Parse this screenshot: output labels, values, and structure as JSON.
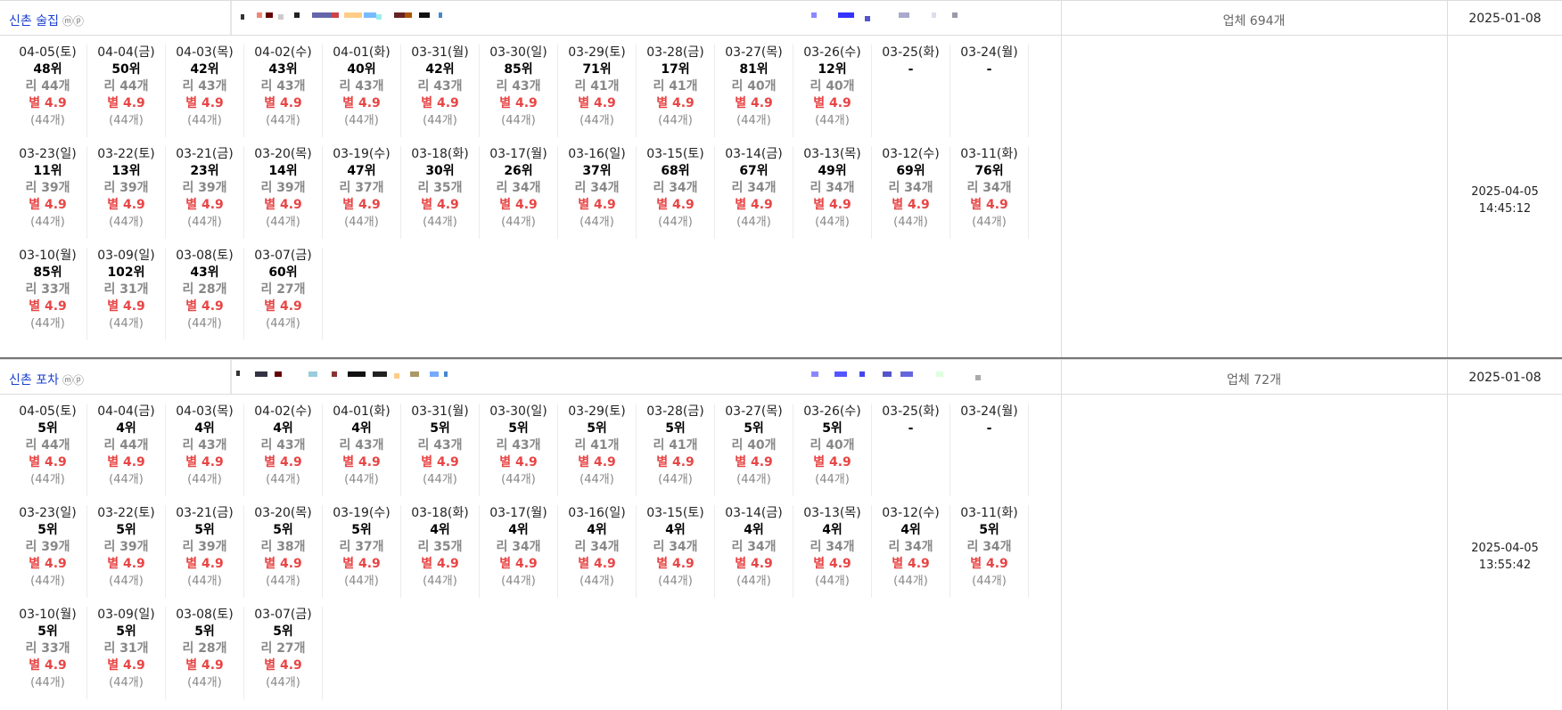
{
  "groups": [
    {
      "keyword": "신촌 술집",
      "mp": "ⓜⓟ",
      "business_count": "업체 694개",
      "registered": "2025-01-08",
      "updated_date": "2025-04-05",
      "updated_time": "14:45:12",
      "days": [
        {
          "date": "04-05(토)",
          "rank": "48위",
          "reviews": "리 44개",
          "stars": "별 4.9",
          "count": "(44개)"
        },
        {
          "date": "04-04(금)",
          "rank": "50위",
          "reviews": "리 44개",
          "stars": "별 4.9",
          "count": "(44개)"
        },
        {
          "date": "04-03(목)",
          "rank": "42위",
          "reviews": "리 43개",
          "stars": "별 4.9",
          "count": "(44개)"
        },
        {
          "date": "04-02(수)",
          "rank": "43위",
          "reviews": "리 43개",
          "stars": "별 4.9",
          "count": "(44개)"
        },
        {
          "date": "04-01(화)",
          "rank": "40위",
          "reviews": "리 43개",
          "stars": "별 4.9",
          "count": "(44개)"
        },
        {
          "date": "03-31(월)",
          "rank": "42위",
          "reviews": "리 43개",
          "stars": "별 4.9",
          "count": "(44개)"
        },
        {
          "date": "03-30(일)",
          "rank": "85위",
          "reviews": "리 43개",
          "stars": "별 4.9",
          "count": "(44개)"
        },
        {
          "date": "03-29(토)",
          "rank": "71위",
          "reviews": "리 41개",
          "stars": "별 4.9",
          "count": "(44개)"
        },
        {
          "date": "03-28(금)",
          "rank": "17위",
          "reviews": "리 41개",
          "stars": "별 4.9",
          "count": "(44개)"
        },
        {
          "date": "03-27(목)",
          "rank": "81위",
          "reviews": "리 40개",
          "stars": "별 4.9",
          "count": "(44개)"
        },
        {
          "date": "03-26(수)",
          "rank": "12위",
          "reviews": "리 40개",
          "stars": "별 4.9",
          "count": "(44개)"
        },
        {
          "date": "03-25(화)",
          "rank": "-",
          "reviews": "",
          "stars": "",
          "count": ""
        },
        {
          "date": "03-24(월)",
          "rank": "-",
          "reviews": "",
          "stars": "",
          "count": ""
        },
        {
          "date": "03-23(일)",
          "rank": "11위",
          "reviews": "리 39개",
          "stars": "별 4.9",
          "count": "(44개)"
        },
        {
          "date": "03-22(토)",
          "rank": "13위",
          "reviews": "리 39개",
          "stars": "별 4.9",
          "count": "(44개)"
        },
        {
          "date": "03-21(금)",
          "rank": "23위",
          "reviews": "리 39개",
          "stars": "별 4.9",
          "count": "(44개)"
        },
        {
          "date": "03-20(목)",
          "rank": "14위",
          "reviews": "리 39개",
          "stars": "별 4.9",
          "count": "(44개)"
        },
        {
          "date": "03-19(수)",
          "rank": "47위",
          "reviews": "리 37개",
          "stars": "별 4.9",
          "count": "(44개)"
        },
        {
          "date": "03-18(화)",
          "rank": "30위",
          "reviews": "리 35개",
          "stars": "별 4.9",
          "count": "(44개)"
        },
        {
          "date": "03-17(월)",
          "rank": "26위",
          "reviews": "리 34개",
          "stars": "별 4.9",
          "count": "(44개)"
        },
        {
          "date": "03-16(일)",
          "rank": "37위",
          "reviews": "리 34개",
          "stars": "별 4.9",
          "count": "(44개)"
        },
        {
          "date": "03-15(토)",
          "rank": "68위",
          "reviews": "리 34개",
          "stars": "별 4.9",
          "count": "(44개)"
        },
        {
          "date": "03-14(금)",
          "rank": "67위",
          "reviews": "리 34개",
          "stars": "별 4.9",
          "count": "(44개)"
        },
        {
          "date": "03-13(목)",
          "rank": "49위",
          "reviews": "리 34개",
          "stars": "별 4.9",
          "count": "(44개)"
        },
        {
          "date": "03-12(수)",
          "rank": "69위",
          "reviews": "리 34개",
          "stars": "별 4.9",
          "count": "(44개)"
        },
        {
          "date": "03-11(화)",
          "rank": "76위",
          "reviews": "리 34개",
          "stars": "별 4.9",
          "count": "(44개)"
        },
        {
          "date": "03-10(월)",
          "rank": "85위",
          "reviews": "리 33개",
          "stars": "별 4.9",
          "count": "(44개)"
        },
        {
          "date": "03-09(일)",
          "rank": "102위",
          "reviews": "리 31개",
          "stars": "별 4.9",
          "count": "(44개)"
        },
        {
          "date": "03-08(토)",
          "rank": "43위",
          "reviews": "리 28개",
          "stars": "별 4.9",
          "count": "(44개)"
        },
        {
          "date": "03-07(금)",
          "rank": "60위",
          "reviews": "리 27개",
          "stars": "별 4.9",
          "count": "(44개)"
        }
      ]
    },
    {
      "keyword": "신촌 포차",
      "mp": "ⓜⓟ",
      "business_count": "업체 72개",
      "registered": "2025-01-08",
      "updated_date": "2025-04-05",
      "updated_time": "13:55:42",
      "days": [
        {
          "date": "04-05(토)",
          "rank": "5위",
          "reviews": "리 44개",
          "stars": "별 4.9",
          "count": "(44개)"
        },
        {
          "date": "04-04(금)",
          "rank": "4위",
          "reviews": "리 44개",
          "stars": "별 4.9",
          "count": "(44개)"
        },
        {
          "date": "04-03(목)",
          "rank": "4위",
          "reviews": "리 43개",
          "stars": "별 4.9",
          "count": "(44개)"
        },
        {
          "date": "04-02(수)",
          "rank": "4위",
          "reviews": "리 43개",
          "stars": "별 4.9",
          "count": "(44개)"
        },
        {
          "date": "04-01(화)",
          "rank": "4위",
          "reviews": "리 43개",
          "stars": "별 4.9",
          "count": "(44개)"
        },
        {
          "date": "03-31(월)",
          "rank": "5위",
          "reviews": "리 43개",
          "stars": "별 4.9",
          "count": "(44개)"
        },
        {
          "date": "03-30(일)",
          "rank": "5위",
          "reviews": "리 43개",
          "stars": "별 4.9",
          "count": "(44개)"
        },
        {
          "date": "03-29(토)",
          "rank": "5위",
          "reviews": "리 41개",
          "stars": "별 4.9",
          "count": "(44개)"
        },
        {
          "date": "03-28(금)",
          "rank": "5위",
          "reviews": "리 41개",
          "stars": "별 4.9",
          "count": "(44개)"
        },
        {
          "date": "03-27(목)",
          "rank": "5위",
          "reviews": "리 40개",
          "stars": "별 4.9",
          "count": "(44개)"
        },
        {
          "date": "03-26(수)",
          "rank": "5위",
          "reviews": "리 40개",
          "stars": "별 4.9",
          "count": "(44개)"
        },
        {
          "date": "03-25(화)",
          "rank": "-",
          "reviews": "",
          "stars": "",
          "count": ""
        },
        {
          "date": "03-24(월)",
          "rank": "-",
          "reviews": "",
          "stars": "",
          "count": ""
        },
        {
          "date": "03-23(일)",
          "rank": "5위",
          "reviews": "리 39개",
          "stars": "별 4.9",
          "count": "(44개)"
        },
        {
          "date": "03-22(토)",
          "rank": "5위",
          "reviews": "리 39개",
          "stars": "별 4.9",
          "count": "(44개)"
        },
        {
          "date": "03-21(금)",
          "rank": "5위",
          "reviews": "리 39개",
          "stars": "별 4.9",
          "count": "(44개)"
        },
        {
          "date": "03-20(목)",
          "rank": "5위",
          "reviews": "리 38개",
          "stars": "별 4.9",
          "count": "(44개)"
        },
        {
          "date": "03-19(수)",
          "rank": "5위",
          "reviews": "리 37개",
          "stars": "별 4.9",
          "count": "(44개)"
        },
        {
          "date": "03-18(화)",
          "rank": "4위",
          "reviews": "리 35개",
          "stars": "별 4.9",
          "count": "(44개)"
        },
        {
          "date": "03-17(월)",
          "rank": "4위",
          "reviews": "리 34개",
          "stars": "별 4.9",
          "count": "(44개)"
        },
        {
          "date": "03-16(일)",
          "rank": "4위",
          "reviews": "리 34개",
          "stars": "별 4.9",
          "count": "(44개)"
        },
        {
          "date": "03-15(토)",
          "rank": "4위",
          "reviews": "리 34개",
          "stars": "별 4.9",
          "count": "(44개)"
        },
        {
          "date": "03-14(금)",
          "rank": "4위",
          "reviews": "리 34개",
          "stars": "별 4.9",
          "count": "(44개)"
        },
        {
          "date": "03-13(목)",
          "rank": "4위",
          "reviews": "리 34개",
          "stars": "별 4.9",
          "count": "(44개)"
        },
        {
          "date": "03-12(수)",
          "rank": "4위",
          "reviews": "리 34개",
          "stars": "별 4.9",
          "count": "(44개)"
        },
        {
          "date": "03-11(화)",
          "rank": "5위",
          "reviews": "리 34개",
          "stars": "별 4.9",
          "count": "(44개)"
        },
        {
          "date": "03-10(월)",
          "rank": "5위",
          "reviews": "리 33개",
          "stars": "별 4.9",
          "count": "(44개)"
        },
        {
          "date": "03-09(일)",
          "rank": "5위",
          "reviews": "리 31개",
          "stars": "별 4.9",
          "count": "(44개)"
        },
        {
          "date": "03-08(토)",
          "rank": "5위",
          "reviews": "리 28개",
          "stars": "별 4.9",
          "count": "(44개)"
        },
        {
          "date": "03-07(금)",
          "rank": "5위",
          "reviews": "리 27개",
          "stars": "별 4.9",
          "count": "(44개)"
        }
      ]
    }
  ]
}
